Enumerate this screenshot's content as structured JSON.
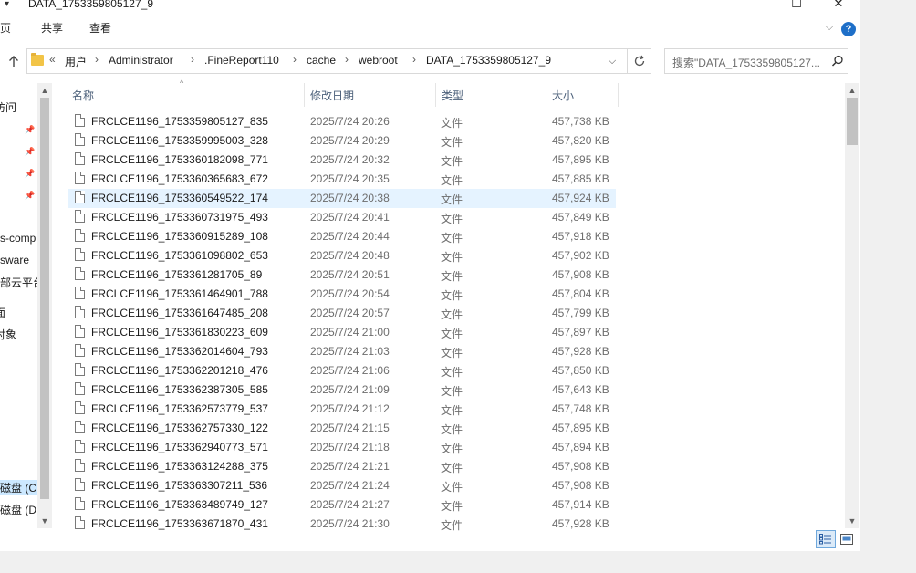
{
  "window": {
    "title": "DATA_1753359805127_9",
    "minimize_glyph": "—",
    "maximize_glyph": "☐",
    "close_glyph": "✕"
  },
  "ribbon": {
    "tabs": [
      {
        "label": "主页"
      },
      {
        "label": "共享"
      },
      {
        "label": "查看"
      }
    ],
    "help_label": "?"
  },
  "address": {
    "breadcrumb_prefix": "«",
    "breadcrumbs": [
      "用户",
      "Administrator",
      ".FineReport110",
      "cache",
      "webroot",
      "DATA_1753359805127_9"
    ]
  },
  "search": {
    "placeholder": "搜索\"DATA_1753359805127..."
  },
  "nav_pane": {
    "items": [
      {
        "label": "访问"
      },
      {
        "label": "s-comp"
      },
      {
        "label": "sware"
      },
      {
        "label": "部云平台"
      },
      {
        "label": "面"
      },
      {
        "label": "对象"
      },
      {
        "label": "磁盘 (C:"
      },
      {
        "label": "磁盘 (D"
      }
    ]
  },
  "columns": {
    "name": "名称",
    "date": "修改日期",
    "type": "类型",
    "size": "大小"
  },
  "files": [
    {
      "name": "FRCLCE1196_1753359805127_835",
      "date": "2025/7/24 20:26",
      "type": "文件",
      "size": "457,738 KB"
    },
    {
      "name": "FRCLCE1196_1753359995003_328",
      "date": "2025/7/24 20:29",
      "type": "文件",
      "size": "457,820 KB"
    },
    {
      "name": "FRCLCE1196_1753360182098_771",
      "date": "2025/7/24 20:32",
      "type": "文件",
      "size": "457,895 KB"
    },
    {
      "name": "FRCLCE1196_1753360365683_672",
      "date": "2025/7/24 20:35",
      "type": "文件",
      "size": "457,885 KB"
    },
    {
      "name": "FRCLCE1196_1753360549522_174",
      "date": "2025/7/24 20:38",
      "type": "文件",
      "size": "457,924 KB"
    },
    {
      "name": "FRCLCE1196_1753360731975_493",
      "date": "2025/7/24 20:41",
      "type": "文件",
      "size": "457,849 KB"
    },
    {
      "name": "FRCLCE1196_1753360915289_108",
      "date": "2025/7/24 20:44",
      "type": "文件",
      "size": "457,918 KB"
    },
    {
      "name": "FRCLCE1196_1753361098802_653",
      "date": "2025/7/24 20:48",
      "type": "文件",
      "size": "457,902 KB"
    },
    {
      "name": "FRCLCE1196_1753361281705_89",
      "date": "2025/7/24 20:51",
      "type": "文件",
      "size": "457,908 KB"
    },
    {
      "name": "FRCLCE1196_1753361464901_788",
      "date": "2025/7/24 20:54",
      "type": "文件",
      "size": "457,804 KB"
    },
    {
      "name": "FRCLCE1196_1753361647485_208",
      "date": "2025/7/24 20:57",
      "type": "文件",
      "size": "457,799 KB"
    },
    {
      "name": "FRCLCE1196_1753361830223_609",
      "date": "2025/7/24 21:00",
      "type": "文件",
      "size": "457,897 KB"
    },
    {
      "name": "FRCLCE1196_1753362014604_793",
      "date": "2025/7/24 21:03",
      "type": "文件",
      "size": "457,928 KB"
    },
    {
      "name": "FRCLCE1196_1753362201218_476",
      "date": "2025/7/24 21:06",
      "type": "文件",
      "size": "457,850 KB"
    },
    {
      "name": "FRCLCE1196_1753362387305_585",
      "date": "2025/7/24 21:09",
      "type": "文件",
      "size": "457,643 KB"
    },
    {
      "name": "FRCLCE1196_1753362573779_537",
      "date": "2025/7/24 21:12",
      "type": "文件",
      "size": "457,748 KB"
    },
    {
      "name": "FRCLCE1196_1753362757330_122",
      "date": "2025/7/24 21:15",
      "type": "文件",
      "size": "457,895 KB"
    },
    {
      "name": "FRCLCE1196_1753362940773_571",
      "date": "2025/7/24 21:18",
      "type": "文件",
      "size": "457,894 KB"
    },
    {
      "name": "FRCLCE1196_1753363124288_375",
      "date": "2025/7/24 21:21",
      "type": "文件",
      "size": "457,908 KB"
    },
    {
      "name": "FRCLCE1196_1753363307211_536",
      "date": "2025/7/24 21:24",
      "type": "文件",
      "size": "457,908 KB"
    },
    {
      "name": "FRCLCE1196_1753363489749_127",
      "date": "2025/7/24 21:27",
      "type": "文件",
      "size": "457,914 KB"
    },
    {
      "name": "FRCLCE1196_1753363671870_431",
      "date": "2025/7/24 21:30",
      "type": "文件",
      "size": "457,928 KB"
    }
  ],
  "hovered_row": 4,
  "colors": {
    "hover": "#e5f3ff",
    "accent": "#1e6fc8",
    "header_text": "#4c607a"
  },
  "icons": {
    "file": "file-icon",
    "folder": "folder-icon",
    "pin": "pin-icon",
    "search": "search-icon",
    "refresh": "refresh-icon",
    "up": "arrow-up-icon",
    "help": "help-icon"
  }
}
